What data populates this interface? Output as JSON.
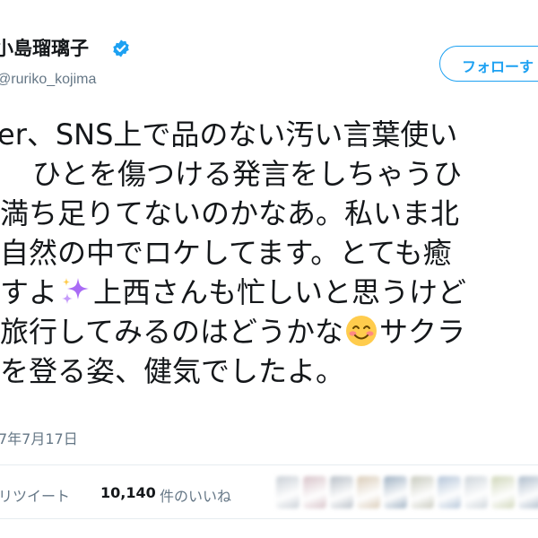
{
  "author": {
    "name": "小島瑠璃子",
    "handle": "@ruriko_kojima",
    "verified": true
  },
  "follow_button": {
    "label": "フォローす"
  },
  "tweet": {
    "lines": [
      "er、SNS上で品のない汚い言葉使い",
      "ひとを傷つける発言をしちゃうひ",
      "満ち足りてないのかなあ。私いま北",
      "自然の中でロケしてます。とても癒",
      [
        "すよ",
        "上西さんも忙しいと思うけど"
      ],
      [
        "旅行してみるのはどうかな",
        "サクラ"
      ],
      "を登る姿、健気でしたよ。"
    ],
    "emojis": [
      "sparkles-icon",
      "smiling-face-icon"
    ]
  },
  "timestamp": "7年7月17日",
  "stats": {
    "retweets_label": "リツイート",
    "likes_count": "10,140",
    "likes_label": "件のいいね"
  },
  "colors": {
    "text": "#14171a",
    "muted": "#657786",
    "accent": "#1da1f2",
    "divider": "#e6ecf0",
    "sparkle": "#a96bf5",
    "emoji_face": "#ffcc4d"
  },
  "liker_avatars": [
    "#c9cfd6",
    "#d7c2c8",
    "#b8bfc7",
    "#d9cbb7",
    "#9eb0c2",
    "#c7c9bd",
    "#b3c4d8",
    "#cdd4da",
    "#cfd6b9",
    "#aebccb"
  ]
}
